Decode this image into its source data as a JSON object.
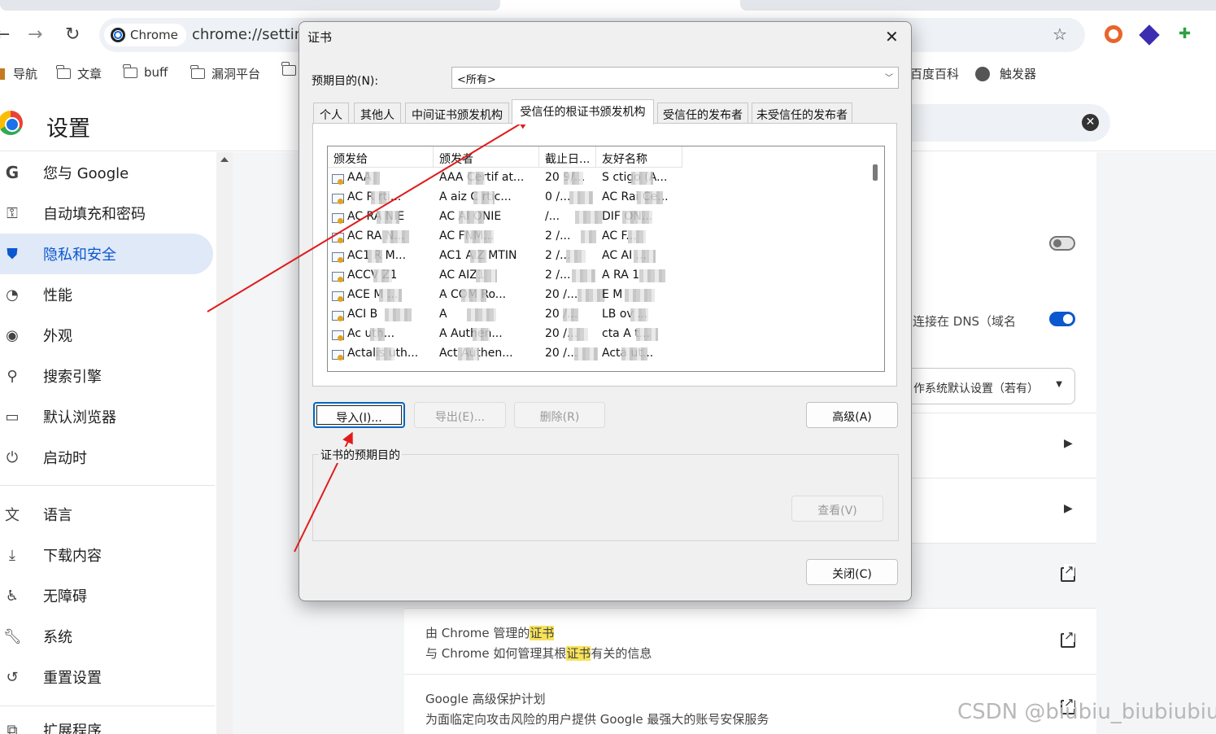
{
  "browser": {
    "chip_label": "Chrome",
    "url": "chrome://settin",
    "bookmarks": [
      {
        "label": "导航"
      },
      {
        "label": "文章"
      },
      {
        "label": "buff"
      },
      {
        "label": "漏洞平台"
      },
      {
        "label": "百度百科"
      },
      {
        "label": "触发器"
      }
    ]
  },
  "settings": {
    "title": "设置",
    "sidebar": [
      {
        "label": "您与 Google",
        "icon": "google-icon"
      },
      {
        "label": "自动填充和密码",
        "icon": "key-icon"
      },
      {
        "label": "隐私和安全",
        "icon": "shield-icon",
        "active": true
      },
      {
        "label": "性能",
        "icon": "speedometer-icon"
      },
      {
        "label": "外观",
        "icon": "palette-icon"
      },
      {
        "label": "搜索引擎",
        "icon": "search-icon"
      },
      {
        "label": "默认浏览器",
        "icon": "browser-window-icon"
      },
      {
        "label": "启动时",
        "icon": "power-icon"
      },
      {
        "label": "语言",
        "icon": "translate-icon"
      },
      {
        "label": "下载内容",
        "icon": "download-icon"
      },
      {
        "label": "无障碍",
        "icon": "accessibility-icon"
      },
      {
        "label": "系统",
        "icon": "wrench-icon"
      },
      {
        "label": "重置设置",
        "icon": "reset-icon"
      },
      {
        "label": "扩展程序",
        "icon": "puzzle-icon"
      }
    ],
    "dns_text": "连接在 DNS（域名",
    "dns_dropdown": "作系统默认设置（若有）",
    "cert_title_prefix": "由 Chrome 管理的",
    "cert_title_hl": "证书",
    "cert_desc_prefix": "与 Chrome 如何管理其根",
    "cert_desc_hl": "证书",
    "cert_desc_suffix": "有关的信息",
    "adv_title": "Google 高级保护计划",
    "adv_desc": "为面临定向攻击风险的用户提供 Google 最强大的账号安保服务"
  },
  "dialog": {
    "title": "证书",
    "purpose_label": "预期目的(N):",
    "purpose_value": "<所有>",
    "tabs": [
      "个人",
      "其他人",
      "中间证书颁发机构",
      "受信任的根证书颁发机构",
      "受信任的发布者",
      "未受信任的发布者"
    ],
    "selected_tab": "受信任的根证书颁发机构",
    "columns": [
      "颁发给",
      "颁发者",
      "截止日...",
      "友好名称"
    ],
    "rows": [
      [
        "AAA",
        "AAA Certif at...",
        "20 9/...",
        "S ctigo (A..."
      ],
      [
        "AC R rti...",
        "A  aiz C rtic...",
        "0 /...",
        "AC Rai Ce..."
      ],
      [
        "AC RA NIE",
        "AC AI ONIE",
        "/...",
        "DIF ON..."
      ],
      [
        "AC RA N...",
        "AC FNM...",
        "2 /...",
        "AC F..."
      ],
      [
        "AC1 R M...",
        "AC1 AIZ MTIN",
        "2 /...",
        "AC AI ..."
      ],
      [
        "ACCV Z1",
        "AC AIZ1",
        "2 /...",
        "A RA 1"
      ],
      [
        "ACE M ...",
        "A COM Ro...",
        "20 /...",
        "E M"
      ],
      [
        "ACI B",
        "A",
        "20 /...",
        "LB ov ..."
      ],
      [
        "Ac uth...",
        "A Authen...",
        "20 /...",
        "cta A t..."
      ],
      [
        "Actalis uth...",
        "Act Authen...",
        "20 /...",
        "Acta ut..."
      ]
    ],
    "import_btn": "导入(I)...",
    "export_btn": "导出(E)...",
    "remove_btn": "删除(R)",
    "advanced_btn": "高级(A)",
    "group_label": "证书的预期目的",
    "view_btn": "查看(V)",
    "close_btn": "关闭(C)"
  },
  "watermark": "CSDN @biubiu_biubiubiu"
}
